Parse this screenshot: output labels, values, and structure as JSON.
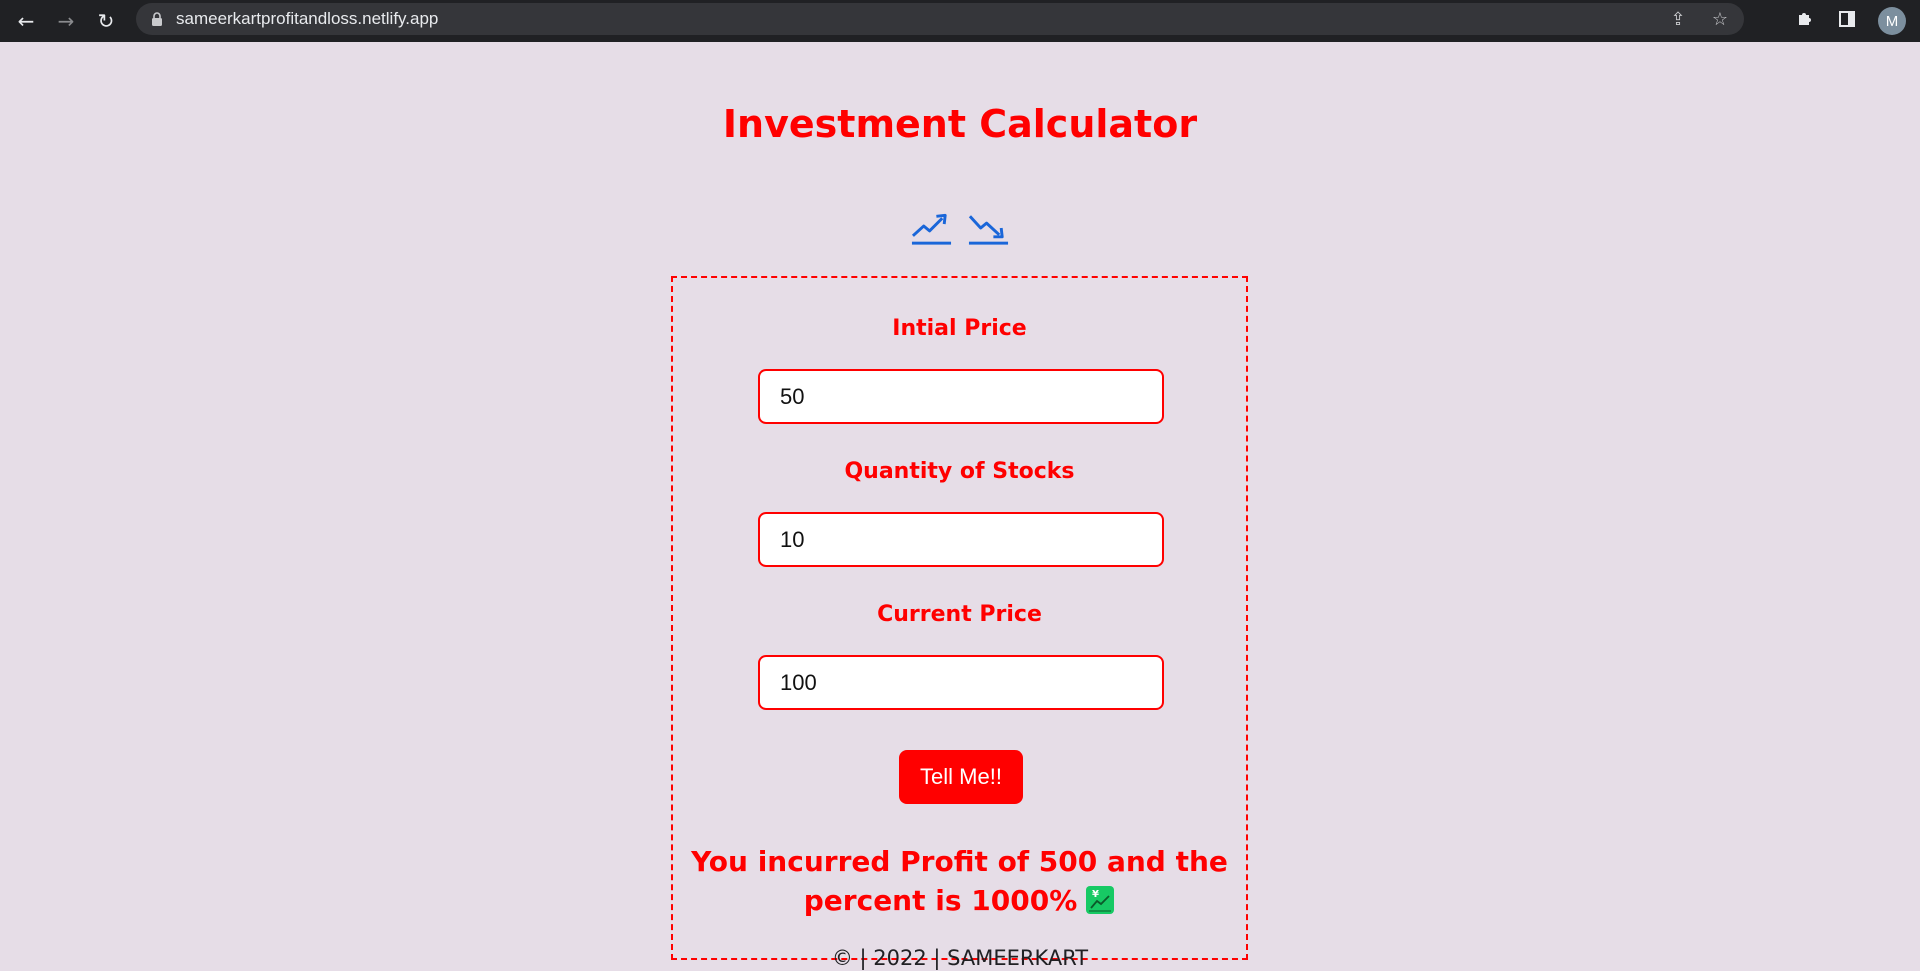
{
  "browser": {
    "url": "sameerkartprofitandloss.netlify.app",
    "avatar_initial": "M"
  },
  "app": {
    "title": "Investment Calculator"
  },
  "form": {
    "initial_price_label": "Intial Price",
    "initial_price_value": "50",
    "quantity_label": "Quantity of Stocks",
    "quantity_value": "10",
    "current_price_label": "Current Price",
    "current_price_value": "100",
    "submit_label": "Tell Me!!"
  },
  "result": {
    "line1": "You incurred Profit of 500 and the",
    "line2": "percent is 1000%"
  },
  "footer": {
    "text": "© | 2022 | SAMEERKART"
  },
  "colors": {
    "accent": "#ff0000",
    "background": "#e6dde7",
    "icon_blue": "#1a66d9",
    "emoji_green": "#17c964"
  },
  "icons": {
    "trend_up": "chart-increasing-icon",
    "trend_down": "chart-decreasing-icon",
    "result": "chart-with-upwards-trend-and-yen-icon"
  }
}
